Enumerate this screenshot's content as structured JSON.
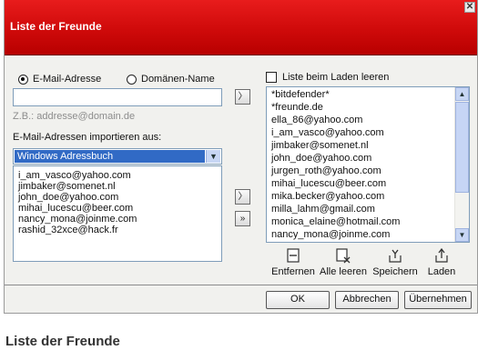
{
  "dialog": {
    "title": "Liste der Freunde",
    "close_glyph": "✕"
  },
  "left": {
    "radio_email": "E-Mail-Adresse",
    "radio_domain": "Domänen-Name",
    "radio_selected": "email",
    "address_value": "",
    "hint": "Z.B.: addresse@domain.de",
    "import_label": "E-Mail-Adressen importieren aus:",
    "import_source": "Windows Adressbuch",
    "contacts": [
      "i_am_vasco@yahoo.com",
      "jimbaker@somenet.nl",
      "john_doe@yahoo.com",
      "mihai_lucescu@beer.com",
      "nancy_mona@joinme.com",
      "rashid_32xce@hack.fr"
    ]
  },
  "right": {
    "clear_on_load_label": "Liste beim Laden leeren",
    "clear_on_load_checked": false,
    "friends": [
      "*bitdefender*",
      "*freunde.de",
      "ella_86@yahoo.com",
      "i_am_vasco@yahoo.com",
      "jimbaker@somenet.nl",
      "john_doe@yahoo.com",
      "jurgen_roth@yahoo.com",
      "mihai_lucescu@beer.com",
      "mika.becker@yahoo.com",
      "milla_lahm@gmail.com",
      "monica_elaine@hotmail.com",
      "nancy_mona@joinme.com"
    ],
    "actions": {
      "remove": "Entfernen",
      "clear_all": "Alle leeren",
      "save": "Speichern",
      "load": "Laden"
    }
  },
  "footer": {
    "ok": "OK",
    "cancel": "Abbrechen",
    "apply": "Übernehmen"
  },
  "caption": "Liste der Freunde",
  "colors": {
    "title_red": "#d10f0f",
    "selection_blue": "#316ac5"
  }
}
